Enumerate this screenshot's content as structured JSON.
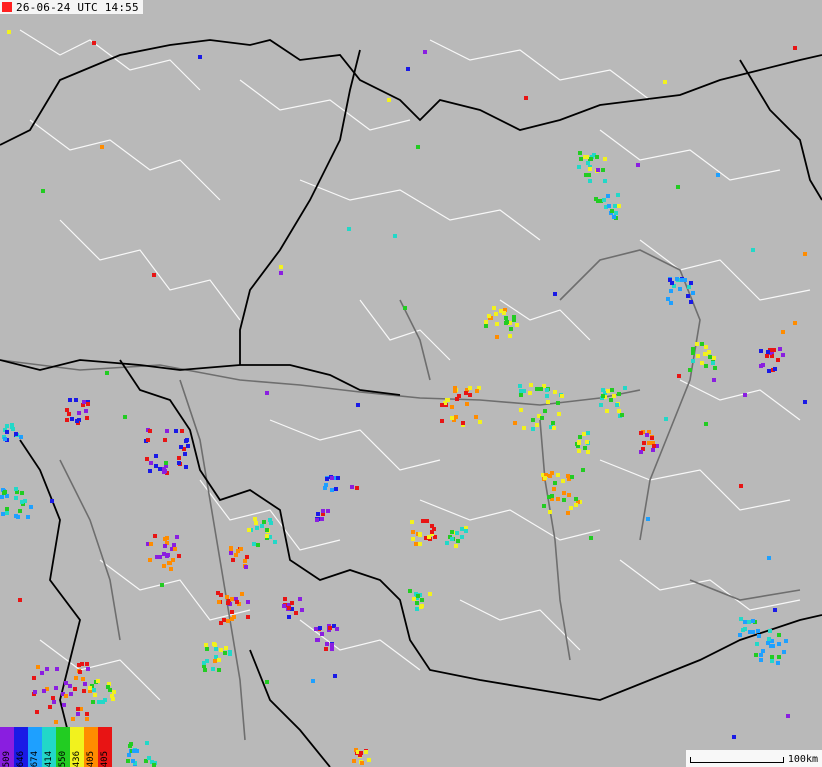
{
  "header": {
    "timestamp": "26-06-24 UTC 14:55",
    "marker_color": "#ff2020"
  },
  "colors": {
    "land": "#b9b9b9",
    "border": "#000000",
    "river": "#6e6e6e",
    "admin": "#ffffff"
  },
  "legend": {
    "cells": [
      {
        "label": "509",
        "color": "#8a1ee0"
      },
      {
        "label": "646",
        "color": "#1a1ae6"
      },
      {
        "label": "674",
        "color": "#1ea0ff"
      },
      {
        "label": "414",
        "color": "#22d8c8"
      },
      {
        "label": "550",
        "color": "#22cc22"
      },
      {
        "label": "436",
        "color": "#f2f21e"
      },
      {
        "label": "405",
        "color": "#ff8c00"
      },
      {
        "label": "405",
        "color": "#e81414"
      }
    ]
  },
  "scale": {
    "label": "100km"
  },
  "map_data": {
    "lightning_clusters": [
      {
        "name": "north-east-1",
        "color": "#ff8c00"
      },
      {
        "name": "north-east-2",
        "color": "#8a1ee0"
      },
      {
        "name": "east-upper",
        "color": "#1a1ae6"
      },
      {
        "name": "east-mid",
        "color": "#1ea0ff"
      },
      {
        "name": "center-danube",
        "color": "#1a1ae6"
      },
      {
        "name": "center-south",
        "color": "#ff8c00"
      },
      {
        "name": "west-hills",
        "color": "#8a1ee0"
      },
      {
        "name": "south-west",
        "color": "#22cc22"
      },
      {
        "name": "south-east",
        "color": "#f2f21e"
      }
    ]
  }
}
